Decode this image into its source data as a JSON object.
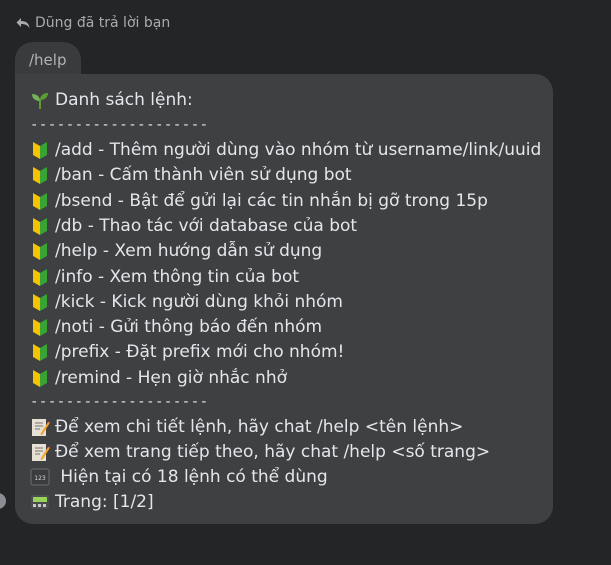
{
  "reply_header": {
    "text": "Dũng đã trả lời bạn",
    "icon": "reply-arrow-icon"
  },
  "quoted_message": {
    "text": "/help"
  },
  "message": {
    "title_icon": "seedling-icon",
    "title": "Danh sách lệnh:",
    "separator_top": "--------------------",
    "command_icon": "beginner-badge-icon",
    "commands": [
      "/add - Thêm người dùng vào nhóm từ username/link/uuid",
      "/ban - Cấm thành viên sử dụng bot",
      "/bsend - Bật để gửi lại các tin nhắn bị gỡ trong 15p",
      "/db - Thao tác với database của bot",
      "/help - Xem hướng dẫn sử dụng",
      "/info - Xem thông tin của bot",
      "/kick - Kick người dùng khỏi nhóm",
      "/noti - Gửi thông báo đến nhóm",
      "/prefix - Đặt prefix mới cho nhóm!",
      "/remind - Hẹn giờ nhắc nhở"
    ],
    "separator_bottom": "--------------------",
    "footer": [
      {
        "icon": "memo-icon",
        "text": "Để xem chi tiết lệnh, hãy chat /help <tên lệnh>"
      },
      {
        "icon": "memo-icon",
        "text": "Để xem trang tiếp theo, hãy chat /help <số trang>"
      },
      {
        "icon": "input-numbers-icon",
        "text": " Hiện tại có 18 lệnh có thể dùng"
      },
      {
        "icon": "pager-icon",
        "text": "Trang: [1/2]"
      }
    ]
  },
  "colors": {
    "background": "#242526",
    "bubble": "#3e4042",
    "text": "#e4e6eb",
    "muted": "#a9abae"
  }
}
